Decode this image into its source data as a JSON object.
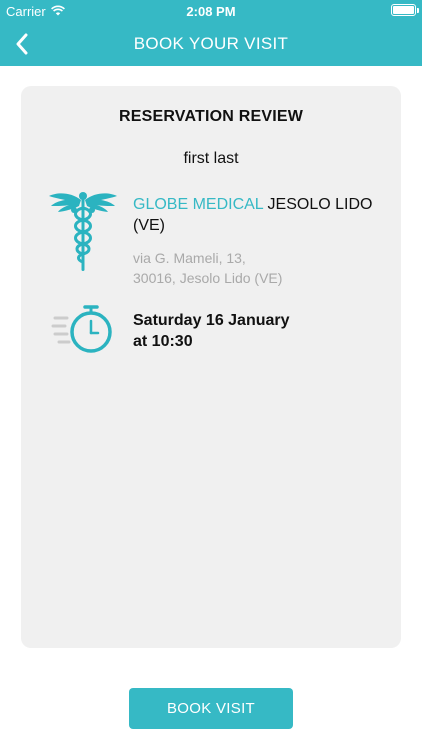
{
  "status_bar": {
    "carrier": "Carrier",
    "time": "2:08 PM",
    "battery_level": 1.0
  },
  "header": {
    "title": "BOOK YOUR VISIT",
    "back_icon": "chevron-left-icon",
    "background_color": "#36b9c5"
  },
  "card": {
    "title": "RESERVATION REVIEW",
    "patient_name": "first last",
    "clinic": {
      "icon": "caduceus-icon",
      "brand": "GLOBE MEDICAL",
      "location": " JESOLO LIDO (VE)",
      "address_line1": "via G. Mameli, 13,",
      "address_line2": "30016, Jesolo Lido (VE)",
      "brand_color": "#36b9c5"
    },
    "appointment": {
      "icon": "stopwatch-icon",
      "date": "Saturday 16 January",
      "time": "at 10:30"
    }
  },
  "footer": {
    "book_button_label": "BOOK VISIT"
  }
}
